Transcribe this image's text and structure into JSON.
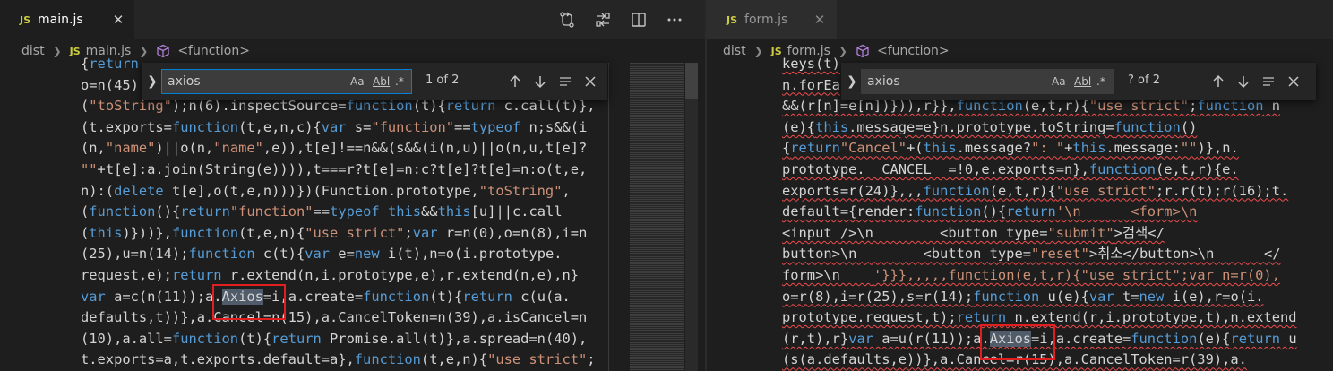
{
  "colors": {
    "background": "#1e1e1e",
    "keyword": "#569cd6",
    "string": "#ce9178",
    "match_box": "#e02020",
    "js_badge": "#cbcb41"
  },
  "left_editor": {
    "tab": {
      "badge": "JS",
      "title": "main.js",
      "close_icon": "close-icon",
      "active": true
    },
    "actions": [
      "open-changes-icon",
      "compare-icon",
      "split-editor-icon",
      "more-actions-icon"
    ],
    "breadcrumb": {
      "folder": "dist",
      "file_badge": "JS",
      "file": "main.js",
      "symbol": "<function>",
      "symbol_icon": "cube-icon"
    },
    "find": {
      "query": "axios",
      "options": [
        "Aa",
        "Abl",
        ".*"
      ],
      "count": "1 of 2",
      "focused": true
    },
    "lines": [
      "{return",
      "o=n(45)",
      "(\"toString\");n(6).inspectSource=function(t){return c.call(t)},",
      "(t.exports=function(t,e,n,c){var s=\"function\"==typeof n;s&&(i",
      "(n,\"name\")||o(n,\"name\",e)),t[e]!==n&&(s&&(i(n,u)||o(n,u,t[e]?",
      "\"\"+t[e]:a.join(String(e)))),t===r?t[e]=n:c?t[e]?t[e]=n:o(t,e,",
      "n):(delete t[e],o(t,e,n)))})(Function.prototype,\"toString\",",
      "(function(){return\"function\"==typeof this&&this[u]||c.call",
      "(this)}))},function(t,e,n){\"use strict\";var r=n(0),o=n(8),i=n",
      "(25),u=n(14);function c(t){var e=new i(t),n=o(i.prototype.",
      "request,e);return r.extend(n,i.prototype,e),r.extend(n,e),n}",
      "var a=c(n(11));a.Axios=i,a.create=function(t){return c(u(a.",
      "defaults,t))},a.Cancel=n(15),a.CancelToken=n(39),a.isCancel=n",
      "(10),a.all=function(t){return Promise.all(t)},a.spread=n(40),",
      "t.exports=a,t.exports.default=a},function(t,e,n){\"use strict\";"
    ]
  },
  "right_editor": {
    "tab": {
      "badge": "JS",
      "title": "form.js",
      "close_icon": "close-icon",
      "active": false
    },
    "breadcrumb": {
      "folder": "dist",
      "file_badge": "JS",
      "file": "form.js",
      "symbol": "<function>",
      "symbol_icon": "cube-icon"
    },
    "find": {
      "query": "axios",
      "options": [
        "Aa",
        "Abl",
        ".*"
      ],
      "count": "? of 2",
      "focused": false
    },
    "lines": [
      "keys(t)",
      "n.forEa",
      "&&(r[n]=e[n])})),r}},function(e,t,r){\"use strict\";function n",
      "(e){this.message=e}n.prototype.toString=function()",
      "{return\"Cancel\"+(this.message?\": \"+this.message:\"\")},n.",
      "prototype.__CANCEL__=!0,e.exports=n},function(e,t,r){e.",
      "exports=r(24)},,,function(e,t,r){\"use strict\";r.r(t);r(16);t.",
      "default={render:function(){return'\\n      <form>\\n",
      "<input />\\n        <button type=\"submit\">검색</",
      "button>\\n        <button type=\"reset\">취소</button>\\n      </",
      "form>\\n    '}}},,,,,function(e,t,r){\"use strict\";var n=r(0),",
      "o=r(8),i=r(25),s=r(14);function u(e){var t=new i(e),r=o(i.",
      "prototype.request,t);return n.extend(r,i.prototype,t),n.extend",
      "(r,t),r}var a=u(r(11));a.Axios=i,a.create=function(e){return u",
      "(s(a.defaults,e))},a.Cancel=r(15),a.CancelToken=r(39),a."
    ]
  }
}
